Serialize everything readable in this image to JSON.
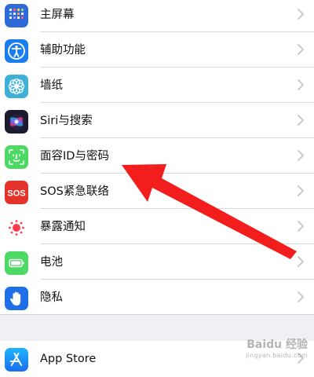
{
  "settings": {
    "items": [
      {
        "label": "主屏幕",
        "icon": "home-screen-icon",
        "color": "#2e6bd8"
      },
      {
        "label": "辅助功能",
        "icon": "accessibility-icon",
        "color": "#1a7df0"
      },
      {
        "label": "墙纸",
        "icon": "wallpaper-flower-icon",
        "color": "#3fb1d8"
      },
      {
        "label": "Siri与搜索",
        "icon": "siri-icon",
        "color": "#222236"
      },
      {
        "label": "面容ID与密码",
        "icon": "face-id-icon",
        "color": "#4cd964"
      },
      {
        "label": "SOS紧急联络",
        "icon": "sos-icon",
        "color": "#e4332b"
      },
      {
        "label": "暴露通知",
        "icon": "exposure-notification-icon",
        "color": "#ffffff"
      },
      {
        "label": "电池",
        "icon": "battery-icon",
        "color": "#4cd964"
      },
      {
        "label": "隐私",
        "icon": "privacy-hand-icon",
        "color": "#1f6fe6"
      }
    ],
    "store": {
      "label": "App Store",
      "icon": "app-store-icon",
      "color": "#1a8cf5"
    }
  },
  "watermark": {
    "main": "Baidu 经验",
    "sub": "jingyan.baidu.com"
  },
  "annotation": {
    "color": "#f21d1d"
  }
}
